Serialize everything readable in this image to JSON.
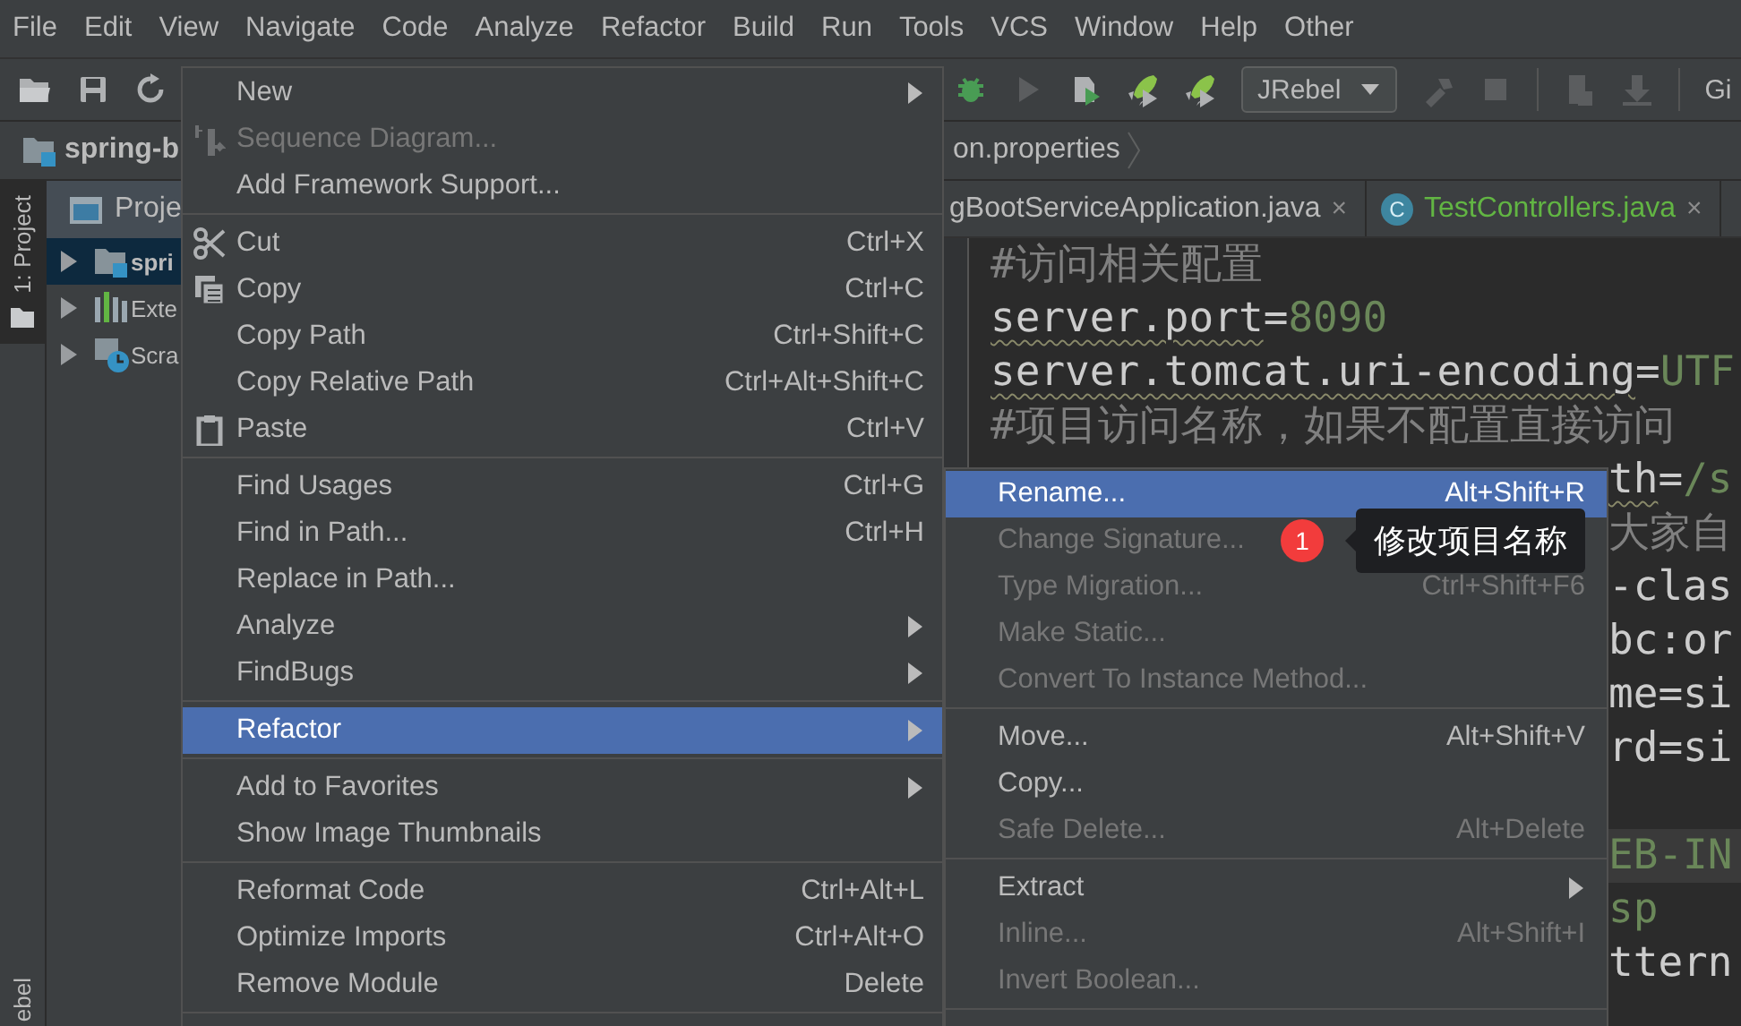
{
  "menubar": [
    {
      "label": "File"
    },
    {
      "label": "Edit"
    },
    {
      "label": "View"
    },
    {
      "label": "Navigate"
    },
    {
      "label": "Code"
    },
    {
      "label": "Analyze"
    },
    {
      "label": "Refactor"
    },
    {
      "label": "Build"
    },
    {
      "label": "Run"
    },
    {
      "label": "Tools"
    },
    {
      "label": "VCS"
    },
    {
      "label": "Window"
    },
    {
      "label": "Help"
    },
    {
      "label": "Other"
    }
  ],
  "toolbar": {
    "run_config": "JRebel",
    "trailing_text": "Gi"
  },
  "breadcrumb": [
    {
      "label": "spring-b",
      "kind": "project"
    },
    {
      "label": "on.properties",
      "kind": "file"
    }
  ],
  "tool_strip": {
    "tabs": [
      {
        "label": "1: Project",
        "selected": true
      }
    ],
    "bottom_label": "ebel"
  },
  "project_panel": {
    "title": "Proje",
    "tree": [
      {
        "label": "spri",
        "kind": "module",
        "selected": true,
        "expanded": false
      },
      {
        "label": "Exte",
        "kind": "libraries",
        "selected": false,
        "expanded": false
      },
      {
        "label": "Scra",
        "kind": "scratches",
        "selected": false,
        "expanded": false
      }
    ]
  },
  "editor": {
    "tabs": [
      {
        "label": "gBootServiceApplication.java",
        "close": "×",
        "added": false
      },
      {
        "label": "TestControllers.java",
        "badge": "C",
        "close": "×",
        "added": true
      }
    ],
    "lines": [
      {
        "kind": "line",
        "current": false,
        "warn": false,
        "segments": [
          {
            "text": "#访问相关配置",
            "kind": "comment"
          }
        ]
      },
      {
        "kind": "line",
        "current": false,
        "warn": true,
        "segments": [
          {
            "text": "server.port",
            "kind": "key"
          },
          {
            "text": "=",
            "kind": "op"
          },
          {
            "text": "8090",
            "kind": "value"
          }
        ]
      },
      {
        "kind": "line",
        "current": false,
        "warn": true,
        "segments": [
          {
            "text": "server.tomcat.uri-encoding",
            "kind": "key"
          },
          {
            "text": "=",
            "kind": "op"
          },
          {
            "text": "UTF",
            "kind": "value"
          }
        ]
      },
      {
        "kind": "line",
        "current": false,
        "warn": false,
        "segments": [
          {
            "text": "#项目访问名称，如果不配置直接访问",
            "kind": "comment"
          }
        ]
      },
      {
        "kind": "tail",
        "current": false,
        "warn": true,
        "segments": [
          {
            "text": "th",
            "kind": "key"
          },
          {
            "text": "=",
            "kind": "op"
          },
          {
            "text": "/s",
            "kind": "value"
          }
        ]
      },
      {
        "kind": "tail",
        "current": false,
        "warn": false,
        "segments": [
          {
            "text": "大家自",
            "kind": "comment"
          }
        ]
      },
      {
        "kind": "tail",
        "current": false,
        "warn": false,
        "segments": [
          {
            "text": "-clas",
            "kind": "key"
          }
        ]
      },
      {
        "kind": "tail",
        "current": false,
        "warn": false,
        "segments": [
          {
            "text": "bc:or",
            "kind": "key"
          }
        ]
      },
      {
        "kind": "tail",
        "current": false,
        "warn": false,
        "segments": [
          {
            "text": "me=si",
            "kind": "key"
          }
        ]
      },
      {
        "kind": "tail",
        "current": false,
        "warn": false,
        "segments": [
          {
            "text": "rd=si",
            "kind": "key"
          }
        ]
      },
      {
        "kind": "blank"
      },
      {
        "kind": "tail",
        "current": true,
        "warn": false,
        "segments": [
          {
            "text": "EB-IN",
            "kind": "value"
          }
        ]
      },
      {
        "kind": "tail",
        "current": false,
        "warn": false,
        "segments": [
          {
            "text": "sp",
            "kind": "value"
          }
        ]
      },
      {
        "kind": "tail",
        "current": false,
        "warn": false,
        "segments": [
          {
            "text": "ttern",
            "kind": "key"
          }
        ]
      }
    ]
  },
  "context_menu": {
    "items": [
      {
        "kind": "item",
        "label": "New",
        "submenu": true,
        "disabled": false,
        "selected": false
      },
      {
        "kind": "item",
        "label": "Sequence Diagram...",
        "submenu": false,
        "disabled": true,
        "selected": false
      },
      {
        "kind": "item",
        "label": "Add Framework Support...",
        "submenu": false,
        "disabled": false,
        "selected": false
      },
      {
        "kind": "separator"
      },
      {
        "kind": "item",
        "label": "Cut",
        "shortcut": "Ctrl+X",
        "submenu": false,
        "disabled": false,
        "selected": false
      },
      {
        "kind": "item",
        "label": "Copy",
        "shortcut": "Ctrl+C",
        "submenu": false,
        "disabled": false,
        "selected": false
      },
      {
        "kind": "item",
        "label": "Copy Path",
        "shortcut": "Ctrl+Shift+C",
        "submenu": false,
        "disabled": false,
        "selected": false
      },
      {
        "kind": "item",
        "label": "Copy Relative Path",
        "shortcut": "Ctrl+Alt+Shift+C",
        "submenu": false,
        "disabled": false,
        "selected": false
      },
      {
        "kind": "item",
        "label": "Paste",
        "shortcut": "Ctrl+V",
        "submenu": false,
        "disabled": false,
        "selected": false
      },
      {
        "kind": "separator"
      },
      {
        "kind": "item",
        "label": "Find Usages",
        "shortcut": "Ctrl+G",
        "submenu": false,
        "disabled": false,
        "selected": false
      },
      {
        "kind": "item",
        "label": "Find in Path...",
        "shortcut": "Ctrl+H",
        "submenu": false,
        "disabled": false,
        "selected": false
      },
      {
        "kind": "item",
        "label": "Replace in Path...",
        "submenu": false,
        "disabled": false,
        "selected": false
      },
      {
        "kind": "item",
        "label": "Analyze",
        "submenu": true,
        "disabled": false,
        "selected": false
      },
      {
        "kind": "item",
        "label": "FindBugs",
        "submenu": true,
        "disabled": false,
        "selected": false
      },
      {
        "kind": "separator"
      },
      {
        "kind": "item",
        "label": "Refactor",
        "submenu": true,
        "disabled": false,
        "selected": true
      },
      {
        "kind": "separator"
      },
      {
        "kind": "item",
        "label": "Add to Favorites",
        "submenu": true,
        "disabled": false,
        "selected": false
      },
      {
        "kind": "item",
        "label": "Show Image Thumbnails",
        "submenu": false,
        "disabled": false,
        "selected": false
      },
      {
        "kind": "separator"
      },
      {
        "kind": "item",
        "label": "Reformat Code",
        "shortcut": "Ctrl+Alt+L",
        "submenu": false,
        "disabled": false,
        "selected": false
      },
      {
        "kind": "item",
        "label": "Optimize Imports",
        "shortcut": "Ctrl+Alt+O",
        "submenu": false,
        "disabled": false,
        "selected": false
      },
      {
        "kind": "item",
        "label": "Remove Module",
        "shortcut": "Delete",
        "submenu": false,
        "disabled": false,
        "selected": false
      },
      {
        "kind": "separator"
      }
    ]
  },
  "submenu": {
    "items": [
      {
        "kind": "item",
        "label": "Rename...",
        "shortcut": "Alt+Shift+R",
        "submenu": false,
        "disabled": false,
        "selected": true
      },
      {
        "kind": "item",
        "label": "Change Signature...",
        "submenu": false,
        "disabled": true,
        "selected": false
      },
      {
        "kind": "item",
        "label": "Type Migration...",
        "shortcut": "Ctrl+Shift+F6",
        "submenu": false,
        "disabled": true,
        "selected": false
      },
      {
        "kind": "item",
        "label": "Make Static...",
        "submenu": false,
        "disabled": true,
        "selected": false
      },
      {
        "kind": "item",
        "label": "Convert To Instance Method...",
        "submenu": false,
        "disabled": true,
        "selected": false
      },
      {
        "kind": "separator"
      },
      {
        "kind": "item",
        "label": "Move...",
        "shortcut": "Alt+Shift+V",
        "submenu": false,
        "disabled": false,
        "selected": false
      },
      {
        "kind": "item",
        "label": "Copy...",
        "submenu": false,
        "disabled": false,
        "selected": false
      },
      {
        "kind": "item",
        "label": "Safe Delete...",
        "shortcut": "Alt+Delete",
        "submenu": false,
        "disabled": true,
        "selected": false
      },
      {
        "kind": "separator"
      },
      {
        "kind": "item",
        "label": "Extract",
        "submenu": true,
        "disabled": false,
        "selected": false
      },
      {
        "kind": "item",
        "label": "Inline...",
        "shortcut": "Alt+Shift+I",
        "submenu": false,
        "disabled": true,
        "selected": false
      },
      {
        "kind": "item",
        "label": "Invert Boolean...",
        "submenu": false,
        "disabled": true,
        "selected": false
      },
      {
        "kind": "separator"
      }
    ]
  },
  "annotation": {
    "number": "1",
    "text": "修改项目名称"
  }
}
